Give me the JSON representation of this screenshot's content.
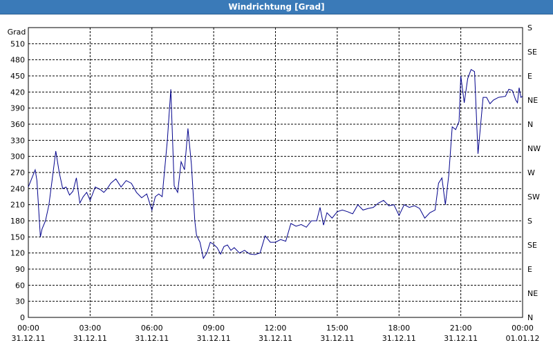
{
  "window": {
    "title": "Windrichtung [Grad]"
  },
  "chart_data": {
    "type": "line",
    "title": "Windrichtung [Grad]",
    "ylabel": "Grad",
    "ylim": [
      0,
      540
    ],
    "yticks": [
      0,
      30,
      60,
      90,
      120,
      150,
      180,
      210,
      240,
      270,
      300,
      330,
      360,
      390,
      420,
      450,
      480,
      510
    ],
    "right_ticks": [
      {
        "value": 0,
        "label": "N"
      },
      {
        "value": 45,
        "label": "NE"
      },
      {
        "value": 90,
        "label": "E"
      },
      {
        "value": 135,
        "label": "SE"
      },
      {
        "value": 180,
        "label": "S"
      },
      {
        "value": 225,
        "label": "SW"
      },
      {
        "value": 270,
        "label": "W"
      },
      {
        "value": 315,
        "label": "NW"
      },
      {
        "value": 360,
        "label": "N"
      },
      {
        "value": 405,
        "label": "NE"
      },
      {
        "value": 450,
        "label": "E"
      },
      {
        "value": 495,
        "label": "SE"
      },
      {
        "value": 540,
        "label": "S"
      }
    ],
    "xlim": [
      "31.12.11 00:00",
      "01.01.12 00:00"
    ],
    "xticks": [
      {
        "time": "00:00",
        "date": "31.12.11"
      },
      {
        "time": "03:00",
        "date": "31.12.11"
      },
      {
        "time": "06:00",
        "date": "31.12.11"
      },
      {
        "time": "09:00",
        "date": "31.12.11"
      },
      {
        "time": "12:00",
        "date": "31.12.11"
      },
      {
        "time": "15:00",
        "date": "31.12.11"
      },
      {
        "time": "18:00",
        "date": "31.12.11"
      },
      {
        "time": "21:00",
        "date": "31.12.11"
      },
      {
        "time": "00:00",
        "date": "01.01.12"
      }
    ],
    "grid": true,
    "series": [
      {
        "color": "#00008b",
        "points": [
          [
            "00:00",
            243
          ],
          [
            "00:20",
            275
          ],
          [
            "00:25",
            255
          ],
          [
            "00:35",
            150
          ],
          [
            "00:40",
            165
          ],
          [
            "00:50",
            180
          ],
          [
            "01:00",
            210
          ],
          [
            "01:10",
            260
          ],
          [
            "01:20",
            310
          ],
          [
            "01:30",
            270
          ],
          [
            "01:40",
            240
          ],
          [
            "01:50",
            243
          ],
          [
            "02:00",
            228
          ],
          [
            "02:10",
            235
          ],
          [
            "02:20",
            260
          ],
          [
            "02:30",
            213
          ],
          [
            "02:40",
            225
          ],
          [
            "02:50",
            233
          ],
          [
            "03:00",
            218
          ],
          [
            "03:15",
            243
          ],
          [
            "03:30",
            238
          ],
          [
            "03:40",
            233
          ],
          [
            "03:50",
            240
          ],
          [
            "04:00",
            250
          ],
          [
            "04:15",
            258
          ],
          [
            "04:30",
            243
          ],
          [
            "04:45",
            255
          ],
          [
            "05:00",
            250
          ],
          [
            "05:15",
            233
          ],
          [
            "05:30",
            223
          ],
          [
            "05:45",
            230
          ],
          [
            "06:00",
            200
          ],
          [
            "06:10",
            225
          ],
          [
            "06:20",
            230
          ],
          [
            "06:30",
            225
          ],
          [
            "06:45",
            330
          ],
          [
            "06:55",
            425
          ],
          [
            "07:05",
            245
          ],
          [
            "07:15",
            233
          ],
          [
            "07:25",
            290
          ],
          [
            "07:35",
            275
          ],
          [
            "07:45",
            352
          ],
          [
            "07:55",
            285
          ],
          [
            "08:05",
            180
          ],
          [
            "08:10",
            153
          ],
          [
            "08:20",
            140
          ],
          [
            "08:30",
            110
          ],
          [
            "08:40",
            120
          ],
          [
            "08:50",
            140
          ],
          [
            "09:00",
            136
          ],
          [
            "09:10",
            130
          ],
          [
            "09:20",
            118
          ],
          [
            "09:30",
            132
          ],
          [
            "09:40",
            135
          ],
          [
            "09:50",
            125
          ],
          [
            "10:00",
            130
          ],
          [
            "10:15",
            120
          ],
          [
            "10:30",
            125
          ],
          [
            "10:45",
            118
          ],
          [
            "11:00",
            117
          ],
          [
            "11:15",
            120
          ],
          [
            "11:30",
            152
          ],
          [
            "11:45",
            140
          ],
          [
            "12:00",
            140
          ],
          [
            "12:15",
            145
          ],
          [
            "12:30",
            142
          ],
          [
            "12:45",
            175
          ],
          [
            "13:00",
            170
          ],
          [
            "13:15",
            173
          ],
          [
            "13:30",
            168
          ],
          [
            "13:45",
            180
          ],
          [
            "14:00",
            180
          ],
          [
            "14:10",
            205
          ],
          [
            "14:20",
            172
          ],
          [
            "14:30",
            195
          ],
          [
            "14:45",
            185
          ],
          [
            "15:00",
            197
          ],
          [
            "15:15",
            200
          ],
          [
            "15:30",
            197
          ],
          [
            "15:45",
            193
          ],
          [
            "16:00",
            210
          ],
          [
            "16:15",
            200
          ],
          [
            "16:30",
            203
          ],
          [
            "16:45",
            205
          ],
          [
            "17:00",
            213
          ],
          [
            "17:15",
            218
          ],
          [
            "17:30",
            208
          ],
          [
            "17:45",
            210
          ],
          [
            "18:00",
            190
          ],
          [
            "18:15",
            210
          ],
          [
            "18:30",
            205
          ],
          [
            "18:45",
            208
          ],
          [
            "19:00",
            203
          ],
          [
            "19:15",
            185
          ],
          [
            "19:30",
            195
          ],
          [
            "19:45",
            200
          ],
          [
            "19:55",
            250
          ],
          [
            "20:05",
            260
          ],
          [
            "20:15",
            210
          ],
          [
            "20:25",
            265
          ],
          [
            "20:35",
            355
          ],
          [
            "20:45",
            350
          ],
          [
            "20:55",
            365
          ],
          [
            "21:00",
            450
          ],
          [
            "21:10",
            400
          ],
          [
            "21:20",
            445
          ],
          [
            "21:30",
            462
          ],
          [
            "21:40",
            458
          ],
          [
            "21:50",
            305
          ],
          [
            "22:05",
            410
          ],
          [
            "22:15",
            410
          ],
          [
            "22:25",
            398
          ],
          [
            "22:35",
            405
          ],
          [
            "22:50",
            410
          ],
          [
            "23:10",
            412
          ],
          [
            "23:20",
            425
          ],
          [
            "23:30",
            423
          ],
          [
            "23:40",
            405
          ],
          [
            "23:45",
            400
          ],
          [
            "23:50",
            428
          ],
          [
            "23:55",
            410
          ],
          [
            "24:00",
            412
          ]
        ]
      }
    ]
  }
}
